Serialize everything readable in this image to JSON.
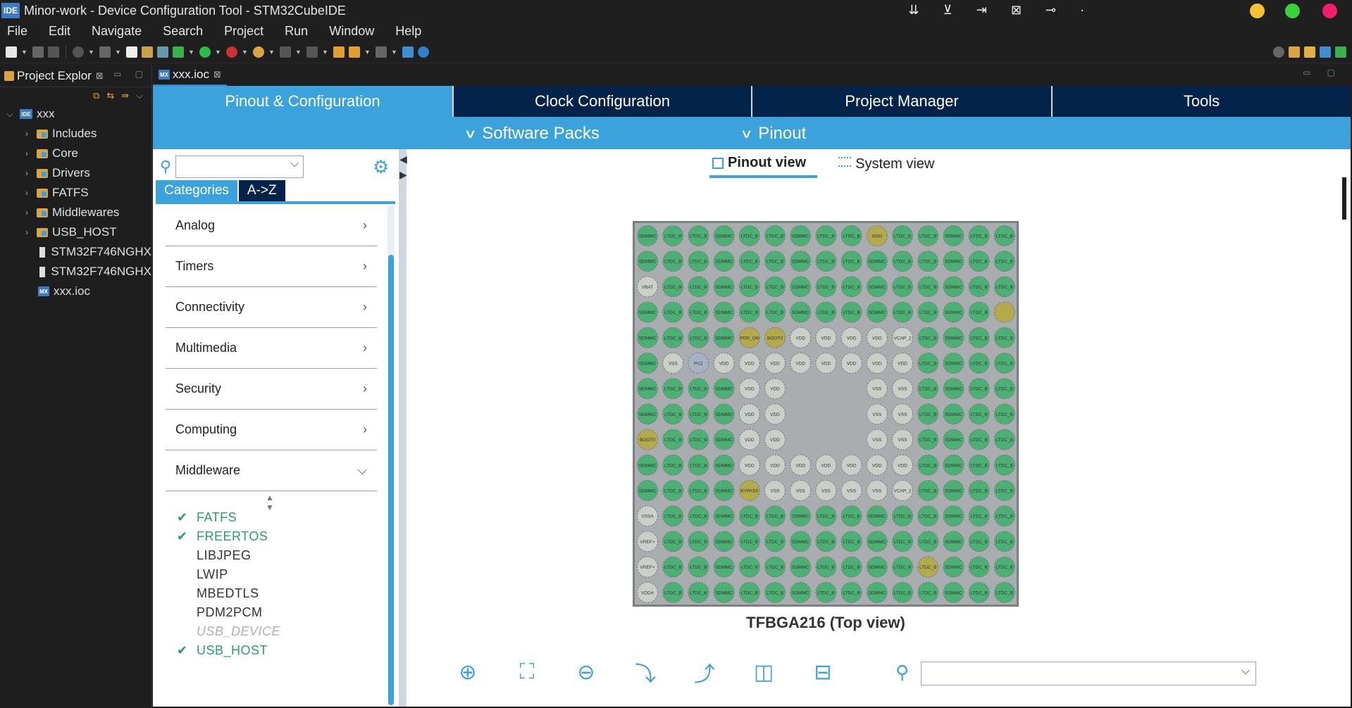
{
  "window": {
    "title": "Minor-work - Device Configuration Tool - STM32CubeIDE",
    "badge": "IDE"
  },
  "menu": [
    "File",
    "Edit",
    "Navigate",
    "Search",
    "Project",
    "Run",
    "Window",
    "Help"
  ],
  "project_explorer": {
    "tab_label": "Project Explor",
    "root": "xxx",
    "items": [
      {
        "label": "Includes",
        "type": "folder"
      },
      {
        "label": "Core",
        "type": "folder"
      },
      {
        "label": "Drivers",
        "type": "folder"
      },
      {
        "label": "FATFS",
        "type": "folder"
      },
      {
        "label": "Middlewares",
        "type": "folder"
      },
      {
        "label": "USB_HOST",
        "type": "folder"
      },
      {
        "label": "STM32F746NGHX",
        "type": "file"
      },
      {
        "label": "STM32F746NGHX",
        "type": "file"
      },
      {
        "label": "xxx.ioc",
        "type": "mx"
      }
    ]
  },
  "editor_tab": {
    "label": "xxx.ioc",
    "badge": "MX"
  },
  "main_tabs": [
    "Pinout & Configuration",
    "Clock Configuration",
    "Project Manager",
    "Tools"
  ],
  "sub_menus": [
    "Software Packs",
    "Pinout"
  ],
  "categories": {
    "tabs": [
      "Categories",
      "A->Z"
    ],
    "items": [
      "Analog",
      "Timers",
      "Connectivity",
      "Multimedia",
      "Security",
      "Computing",
      "Middleware"
    ],
    "middleware": [
      {
        "label": "FATFS",
        "state": "enabled"
      },
      {
        "label": "FREERTOS",
        "state": "enabled"
      },
      {
        "label": "LIBJPEG",
        "state": "available"
      },
      {
        "label": "LWIP",
        "state": "available"
      },
      {
        "label": "MBEDTLS",
        "state": "available"
      },
      {
        "label": "PDM2PCM",
        "state": "available"
      },
      {
        "label": "USB_DEVICE",
        "state": "disabled"
      },
      {
        "label": "USB_HOST",
        "state": "enabled"
      }
    ]
  },
  "pinout": {
    "view_tabs": [
      "Pinout view",
      "System view"
    ],
    "chip_label": "TFBGA216 (Top view)",
    "ball_grid": 15,
    "ball_labels": {
      "gnd": "GND",
      "vdd": "VDD",
      "vss": "VSS",
      "vbat": "VBAT",
      "boot": "BOOT0",
      "pdr": "PDR_ON",
      "vcap": "VCAP_2",
      "pi11": "PI11",
      "byp": "BYPASS",
      "vssa": "VSSA",
      "vref": "VREF+",
      "vdda": "VDDA",
      "sdmmc": "SDMMC",
      "ltdc": "LTDC_B"
    }
  },
  "colors": {
    "accent": "#3ca2dc",
    "navy": "#03234b",
    "ball_green": "#4caf74",
    "ball_yellow": "#b3aa4e",
    "ball_gray": "#cbcfca",
    "ball_blue": "#a6b2c4"
  }
}
